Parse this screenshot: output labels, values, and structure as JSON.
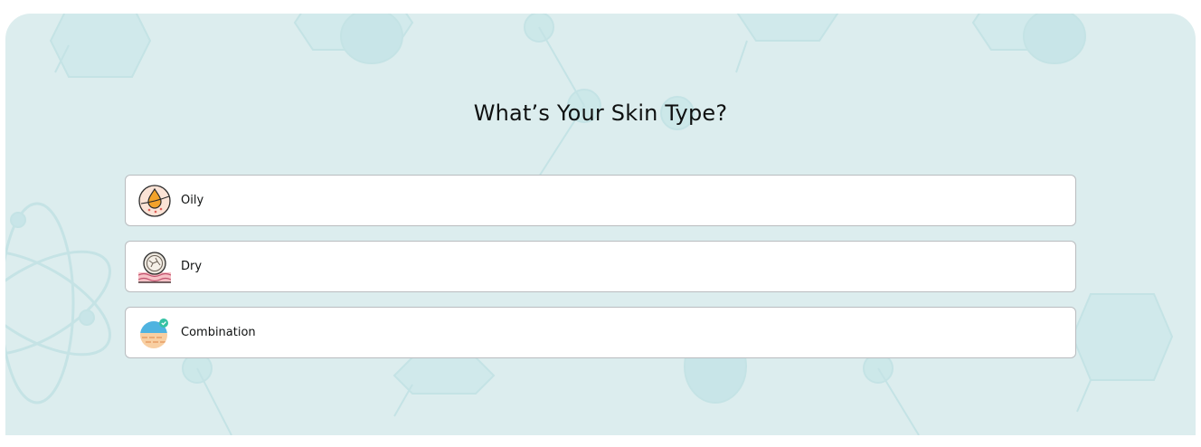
{
  "quiz": {
    "title": "What’s Your Skin Type?",
    "options": [
      {
        "label": "Oily",
        "icon": "oil-drop-skin-icon"
      },
      {
        "label": "Dry",
        "icon": "dry-skin-icon"
      },
      {
        "label": "Combination",
        "icon": "combination-skin-icon"
      }
    ]
  },
  "colors": {
    "background": "#dcedee",
    "pattern": "#c2e2e5",
    "card": "#ffffff",
    "card_border": "#b9bcbf",
    "text": "#0f1111"
  }
}
